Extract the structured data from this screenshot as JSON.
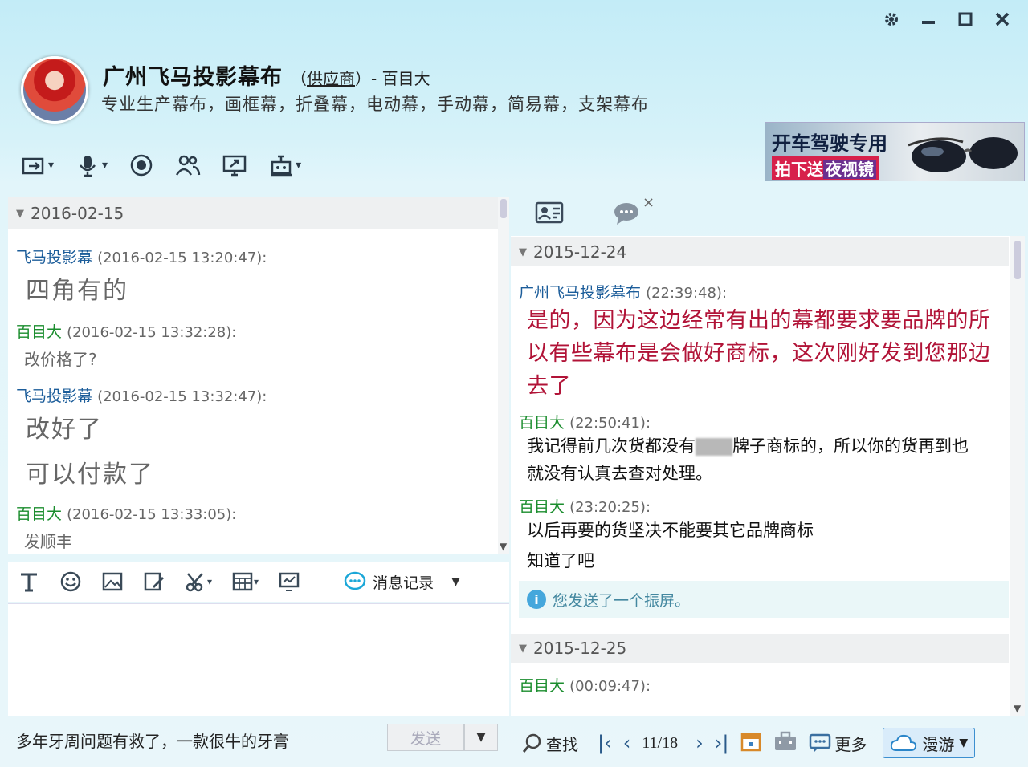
{
  "window": {
    "controls": [
      "settings",
      "minimize",
      "maximize",
      "close"
    ]
  },
  "contact": {
    "name": "广州飞马投影幕布",
    "tag_prefix": "（",
    "tag": "供应商",
    "tag_suffix": "）- 百目大",
    "signature": "专业生产幕布，画框幕，折叠幕，电动幕，手动幕，简易幕，支架幕布"
  },
  "ad": {
    "line1": "开车驾驶专用",
    "line2a": "拍下送",
    "line2b": "夜视镜"
  },
  "left_chat": {
    "date": "2016-02-15",
    "messages": [
      {
        "sender": "飞马投影幕",
        "time": "(2016-02-15 13:20:47):",
        "lines": [
          "四角有的"
        ]
      },
      {
        "sender": "百目大",
        "time": "(2016-02-15 13:32:28):",
        "lines": [
          "改价格了?"
        ]
      },
      {
        "sender": "飞马投影幕",
        "time": "(2016-02-15 13:32:47):",
        "lines": [
          "改好了",
          "可以付款了"
        ]
      },
      {
        "sender": "百目大",
        "time": "(2016-02-15 13:33:05):",
        "lines": [
          "发顺丰"
        ]
      }
    ]
  },
  "edit_bar": {
    "history_label": "消息记录"
  },
  "input": {
    "promo": "多年牙周问题有救了，一款很牛的牙膏",
    "send_label": "发送"
  },
  "right_chat": {
    "dates": [
      "2015-12-24",
      "2015-12-25"
    ],
    "messages": [
      {
        "sender": "广州飞马投影幕布",
        "time": "(22:39:48):",
        "lines": [
          "是的，因为这边经常有出的幕都要求要品牌的所",
          "以有些幕布是会做好商标，这次刚好发到您那边",
          "去了"
        ]
      },
      {
        "sender": "百目大",
        "time": "(22:50:41):",
        "line1a": "我记得前几次货都没有",
        "line1b": "牌子商标的，所以你的货再到也",
        "line2": "就没有认真去查对处理。"
      },
      {
        "sender": "百目大",
        "time": "(23:20:25):",
        "lines": [
          "以后再要的货坚决不能要其它品牌商标",
          "知道了吧"
        ]
      },
      {
        "sender": "百目大",
        "time": "(00:09:47):"
      }
    ],
    "system_note": "您发送了一个振屏。"
  },
  "bottom_nav": {
    "find_label": "查找",
    "page_indicator": "11/18",
    "more_label": "更多",
    "roam_label": "漫游"
  },
  "colors": {
    "partner_name": "#1c5d9a",
    "self_name": "#1b8d2e",
    "highlight_text": "#b11337",
    "system_note": "#4488a0"
  }
}
